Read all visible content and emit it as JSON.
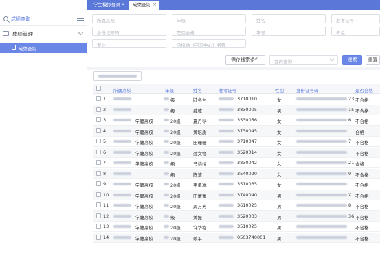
{
  "tabs": [
    {
      "label": "学生模拟登录",
      "active": false
    },
    {
      "label": "成绩查询",
      "active": true
    }
  ],
  "sidebar": {
    "search_label": "成绩查询",
    "group_label": "成绩管理",
    "item_label": "成绩查询"
  },
  "filters": {
    "row1": [
      "所属高校",
      "年级",
      "姓名",
      "准考证号"
    ],
    "row2": [
      "身份证号码",
      "是否合格",
      "学号",
      "考点"
    ],
    "row3": [
      "专业",
      "函授站（学习中心）名称"
    ],
    "save_search": "保存搜索条件",
    "my_query": "我的查询",
    "search": "搜索",
    "reset": "重置"
  },
  "table": {
    "columns": [
      "所属高校",
      "年级",
      "姓名",
      "准考证号",
      "性别",
      "身份证号码",
      "是否合格"
    ],
    "rows": [
      {
        "no": "1",
        "school": "",
        "grade": "级",
        "name": "陆冬兰",
        "exam": "3710010",
        "gender": "女",
        "id": "23",
        "pass": "不合格"
      },
      {
        "no": "2",
        "school": "",
        "grade": "级",
        "name": "戚或",
        "exam": "3830005",
        "gender": "男",
        "id": "15",
        "pass": "不合格"
      },
      {
        "no": "3",
        "school": "学籍高校",
        "grade": "20级",
        "name": "夏丹琴",
        "exam": "3530056",
        "gender": "女",
        "id": "6",
        "pass": "不合格"
      },
      {
        "no": "4",
        "school": "学籍高校",
        "grade": "20级",
        "name": "黄培质",
        "exam": "3730045",
        "gender": "女",
        "id": "",
        "pass": "合格"
      },
      {
        "no": "5",
        "school": "学籍高校",
        "grade": "20级",
        "name": "田珊珊",
        "exam": "3710047",
        "gender": "女",
        "id": "7",
        "pass": "不合格"
      },
      {
        "no": "6",
        "school": "学籍高校",
        "grade": "20级",
        "name": "过文怡",
        "exam": "3520014",
        "gender": "女",
        "id": "",
        "pass": "不合格"
      },
      {
        "no": "7",
        "school": "学籍高校",
        "grade": "级",
        "name": "马靖靖",
        "exam": "3830042",
        "gender": "女",
        "id": "21",
        "pass": "合格"
      },
      {
        "no": "8",
        "school": "",
        "grade": "级",
        "name": "陈洁",
        "exam": "3540020",
        "gender": "女",
        "id": "9",
        "pass": "不合格"
      },
      {
        "no": "9",
        "school": "学籍高校",
        "grade": "20级",
        "name": "韦勇琳",
        "exam": "3510035",
        "gender": "女",
        "id": "",
        "pass": "不合格"
      },
      {
        "no": "10",
        "school": "学籍高校",
        "grade": "20级",
        "name": "田蕾蕾",
        "exam": "3740040",
        "gender": "男",
        "id": "X",
        "pass": "不合格"
      },
      {
        "no": "11",
        "school": "学籍高校",
        "grade": "20级",
        "name": "周万亮",
        "exam": "3610025",
        "gender": "男",
        "id": "8",
        "pass": "不合格"
      },
      {
        "no": "12",
        "school": "学籍高校",
        "grade": "级",
        "name": "黄振",
        "exam": "3520003",
        "gender": "男",
        "id": "36",
        "pass": "不合格"
      },
      {
        "no": "13",
        "school": "学籍高校",
        "grade": "20级",
        "name": "许华榴",
        "exam": "3510025",
        "gender": "男",
        "id": "",
        "pass": "不合格"
      },
      {
        "no": "14",
        "school": "学籍高校",
        "grade": "20级",
        "name": "赖平",
        "exam": "0503740001",
        "gender": "男",
        "id": "",
        "pass": "不合格"
      }
    ]
  }
}
